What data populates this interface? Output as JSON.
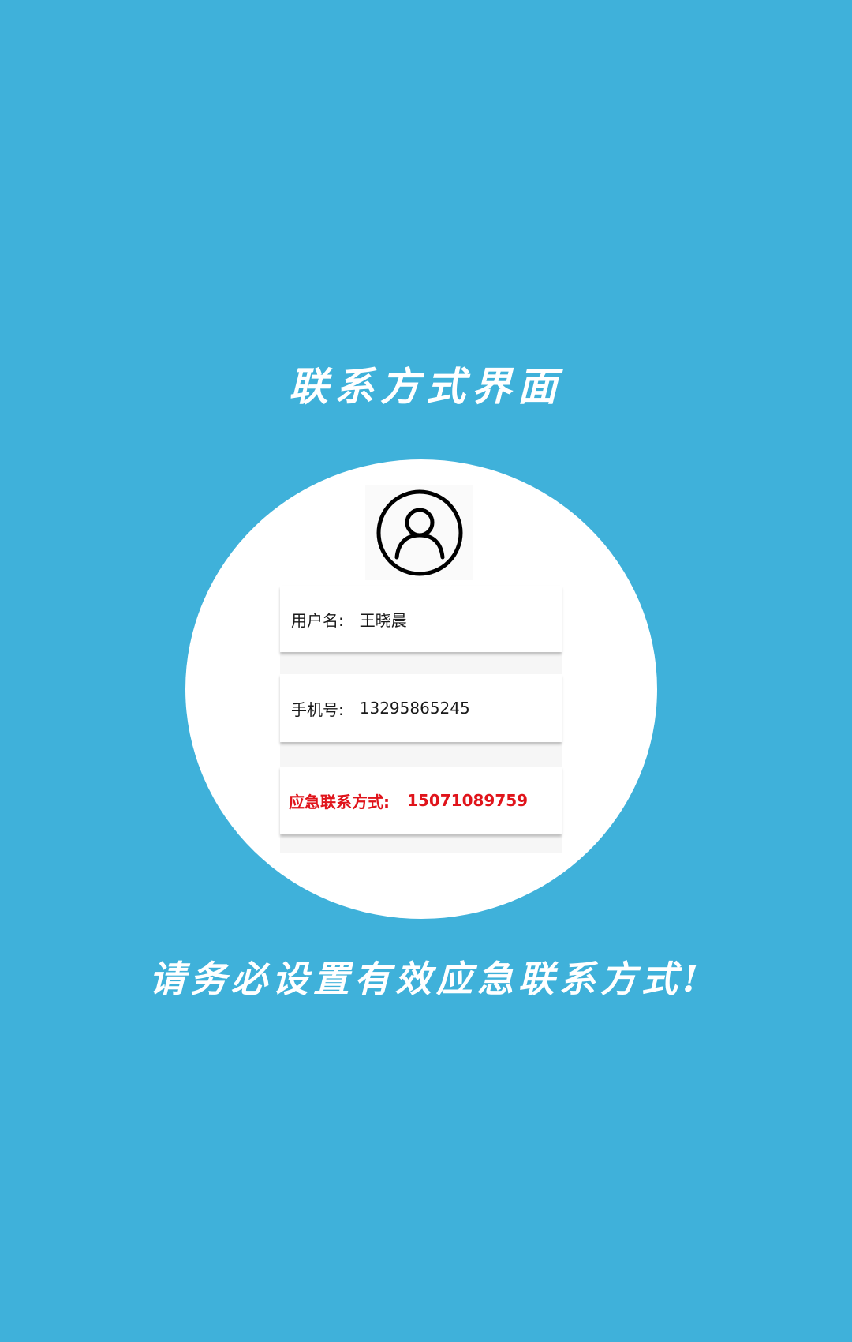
{
  "header": {
    "title": "联系方式界面"
  },
  "profile": {
    "avatar_icon": "user-avatar-icon",
    "username": {
      "label": "用户名:",
      "value": "王晓晨"
    },
    "phone": {
      "label": "手机号:",
      "value": "13295865245"
    },
    "emergency_contact": {
      "label": "应急联系方式:",
      "value": "15071089759"
    }
  },
  "footer": {
    "notice": "请务必设置有效应急联系方式!"
  },
  "colors": {
    "background": "#3fb1da",
    "circle": "#ffffff",
    "emergency_text": "#e0141b",
    "primary_text": "#1a1a1a"
  }
}
